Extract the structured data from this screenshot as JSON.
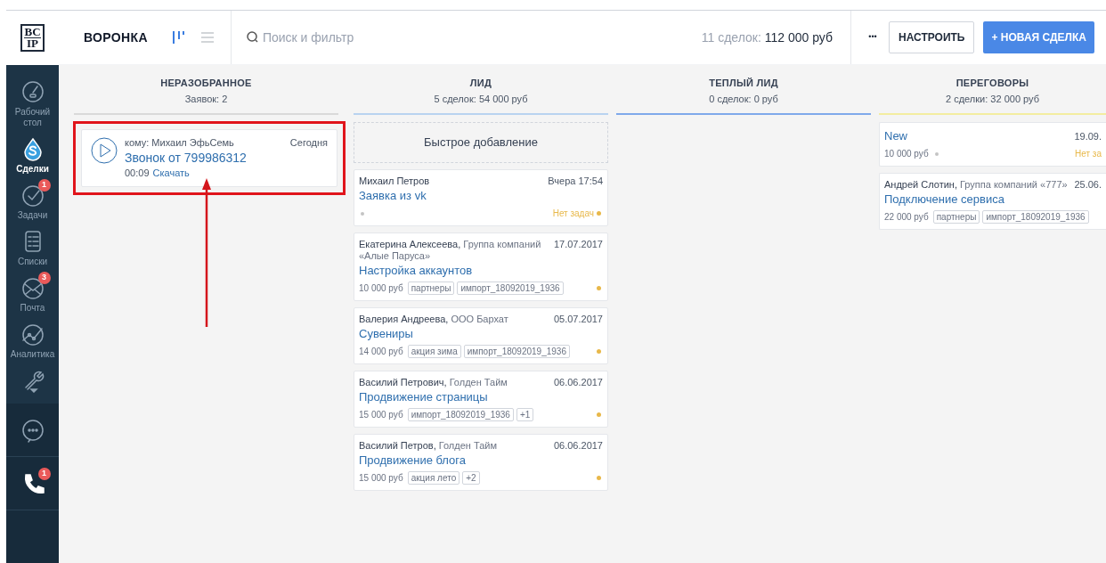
{
  "logo": {
    "lines": [
      "BC",
      "IP"
    ]
  },
  "header": {
    "title": "ВОРОНКА",
    "views": [
      {
        "kind": "pipeline",
        "selected": true
      },
      {
        "kind": "list",
        "selected": false
      }
    ],
    "search": {
      "placeholder": "Поиск и фильтр"
    },
    "totals": {
      "label": "11 сделок:",
      "value": "112 000 руб"
    },
    "more": "•••",
    "buttons": [
      {
        "kind": "secondary",
        "label": "НАСТРОИТЬ"
      },
      {
        "kind": "primary",
        "label": "+ НОВАЯ СДЕЛКА"
      }
    ]
  },
  "sidebar": {
    "items": [
      {
        "kind": "gauge",
        "label": "Рабочий стол",
        "selected": false
      },
      {
        "kind": "deals",
        "label": "Сделки",
        "selected": true
      },
      {
        "kind": "check",
        "label": "Задачи",
        "badge": "1",
        "selected": false
      },
      {
        "kind": "lists",
        "label": "Списки",
        "selected": false
      },
      {
        "kind": "mail",
        "label": "Почта",
        "badge": "3",
        "selected": false
      },
      {
        "kind": "chart",
        "label": "Аналитика",
        "selected": false
      },
      {
        "kind": "tools",
        "selected": false
      }
    ],
    "bottom": [
      {
        "kind": "chat"
      },
      {
        "kind": "phone",
        "badge": "1"
      }
    ]
  },
  "columns": [
    {
      "title": "НЕРАЗОБРАННОЕ",
      "subtitle": "Заявок: 2",
      "color": "#d9d9d9",
      "cards": [
        {
          "kind": "call",
          "to": "кому: Михаил ЭфьСемь",
          "date": "Сегодня",
          "title": "Звонок от 799986312",
          "duration": "00:09",
          "link": "Скачать",
          "highlighted": true
        }
      ]
    },
    {
      "title": "ЛИД",
      "subtitle": "5 сделок: 54 000 руб",
      "color": "#b9d3f0",
      "cards": [
        {
          "kind": "quick_add",
          "label": "Быстрое добавление"
        },
        {
          "kind": "deal",
          "contact": "Михаил Петров",
          "date": "Вчера 17:54",
          "title": "Заявка из vk",
          "left_dot": {
            "color": "#c4c4c4"
          },
          "tasks": {
            "text": "Нет задач",
            "color": "#e8b84a"
          },
          "right_dot": {
            "color": "#e8b84a"
          }
        },
        {
          "kind": "deal",
          "contact": "Екатерина Алексеева,",
          "company": "Группа компаний «Алые Паруса»",
          "date": "17.07.2017",
          "title": "Настройка аккаунтов",
          "price": "10 000 руб",
          "tags": [
            "партнеры",
            "импорт_18092019_1936"
          ],
          "right_dot": {
            "color": "#e8b84a"
          }
        },
        {
          "kind": "deal",
          "contact": "Валерия Андреева,",
          "company": "ООО Бархат",
          "date": "05.07.2017",
          "title": "Сувениры",
          "price": "14 000 руб",
          "tags": [
            "акция зима",
            "импорт_18092019_1936"
          ],
          "right_dot": {
            "color": "#e8b84a"
          }
        },
        {
          "kind": "deal",
          "contact": "Василий Петрович,",
          "company": "Голден Тайм",
          "date": "06.06.2017",
          "title": "Продвижение страницы",
          "price": "15 000 руб",
          "tags": [
            "импорт_18092019_1936",
            "+1"
          ],
          "right_dot": {
            "color": "#e8b84a"
          }
        },
        {
          "kind": "deal",
          "contact": "Василий Петров,",
          "company": "Голден Тайм",
          "date": "06.06.2017",
          "title": "Продвижение блога",
          "price": "15 000 руб",
          "tags": [
            "акция лето",
            "+2"
          ],
          "right_dot": {
            "color": "#e8b84a"
          }
        }
      ]
    },
    {
      "title": "ТЕПЛЫЙ ЛИД",
      "subtitle": "0 сделок: 0 руб",
      "color": "#7fa9ea"
    },
    {
      "title": "ПЕРЕГОВОРЫ",
      "subtitle": "2 сделки: 32 000 руб",
      "color": "#f3eda0",
      "cards": [
        {
          "kind": "deal",
          "date": "19.09.",
          "title": "New",
          "price": "10 000 руб",
          "left_dot": {
            "color": "#c4c4c4"
          },
          "tasks": {
            "text": "Нет за",
            "color": "#e8b84a"
          }
        },
        {
          "kind": "deal",
          "contact": "Андрей Слотин,",
          "company": "Группа компаний «777»",
          "date": "25.06.",
          "title": "Подключение сервиса",
          "price": "22 000 руб",
          "tags": [
            "партнеры",
            "импорт_18092019_1936"
          ]
        }
      ]
    }
  ]
}
